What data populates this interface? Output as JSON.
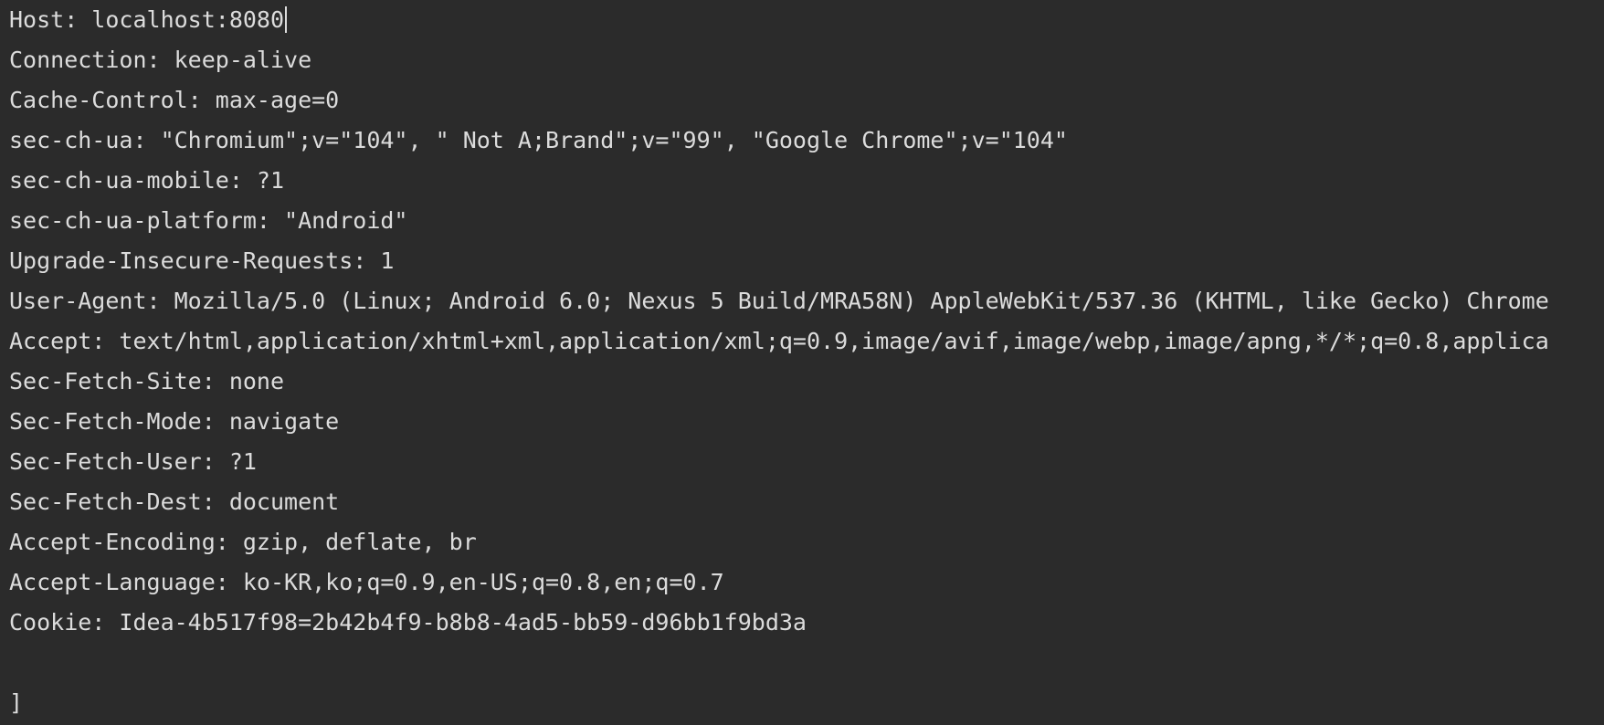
{
  "console": {
    "lines": [
      "Host: localhost:8080",
      "Connection: keep-alive",
      "Cache-Control: max-age=0",
      "sec-ch-ua: \"Chromium\";v=\"104\", \" Not A;Brand\";v=\"99\", \"Google Chrome\";v=\"104\"",
      "sec-ch-ua-mobile: ?1",
      "sec-ch-ua-platform: \"Android\"",
      "Upgrade-Insecure-Requests: 1",
      "User-Agent: Mozilla/5.0 (Linux; Android 6.0; Nexus 5 Build/MRA58N) AppleWebKit/537.36 (KHTML, like Gecko) Chrome",
      "Accept: text/html,application/xhtml+xml,application/xml;q=0.9,image/avif,image/webp,image/apng,*/*;q=0.8,applica",
      "Sec-Fetch-Site: none",
      "Sec-Fetch-Mode: navigate",
      "Sec-Fetch-User: ?1",
      "Sec-Fetch-Dest: document",
      "Accept-Encoding: gzip, deflate, br",
      "Accept-Language: ko-KR,ko;q=0.9,en-US;q=0.8,en;q=0.7",
      "Cookie: Idea-4b517f98=2b42b4f9-b8b8-4ad5-bb59-d96bb1f9bd3a",
      "",
      "]"
    ]
  },
  "colors": {
    "background": "#2b2b2b",
    "text": "#dcdcdc"
  }
}
